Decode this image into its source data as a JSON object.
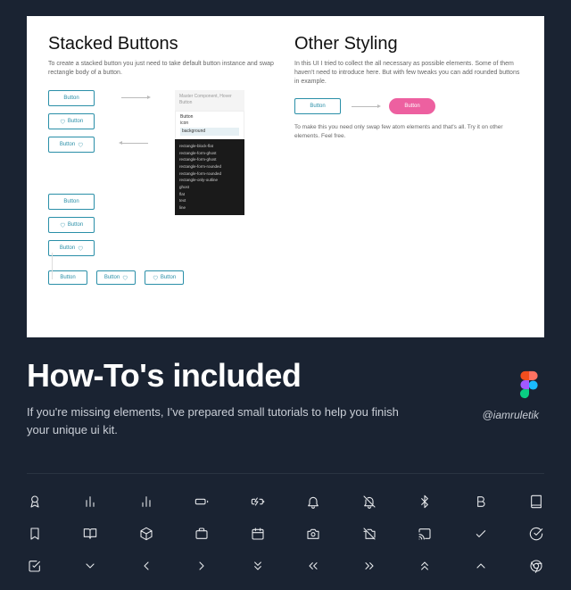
{
  "panel": {
    "left": {
      "title": "Stacked Buttons",
      "desc": "To create a stacked button you just need to take default button instance and swap rectangle body of a button.",
      "btn_label": "Button",
      "figma_head1": "Master Component, Hover",
      "figma_head2": "Button",
      "figma_mid1": "Button",
      "figma_mid2": "icon",
      "figma_mid3": "background",
      "dark_items": [
        "rectangle-block-flat",
        "rectangle-form-ghost",
        "rectangle-form-ghost",
        "rectangle-form-rounded",
        "rectangle-form-rounded",
        "rectangle-only-outline",
        "ghost",
        "flat",
        "text",
        "line"
      ]
    },
    "right": {
      "title": "Other Styling",
      "desc": "In this UI I tried to collect the all necessary as possible elements. Some of them haven't need to introduce here. But with few tweaks you can add rounded buttons in example.",
      "btn_label": "Button",
      "note": "To make this you need only swap few atom elements and that's all. Try it on other elements. Feel free."
    }
  },
  "hero": {
    "title": "How-To's included",
    "subtitle": "If you're missing elements, I've prepared small tutorials to help you finish your unique ui kit."
  },
  "handle": "@iamruletik",
  "icons": {
    "row1": [
      "award",
      "bar-chart",
      "bar-chart-2",
      "battery",
      "battery-charging",
      "bell",
      "bell-off",
      "bluetooth",
      "bold",
      "book"
    ],
    "row2": [
      "bookmark",
      "book-open",
      "box",
      "briefcase",
      "calendar",
      "camera",
      "camera-off",
      "cast",
      "check",
      "check-circle"
    ],
    "row3": [
      "check-square",
      "chevron-down",
      "chevron-left",
      "chevron-right",
      "chevrons-down",
      "chevrons-left",
      "chevrons-right",
      "chevrons-up",
      "chevron-up",
      "chrome"
    ]
  }
}
